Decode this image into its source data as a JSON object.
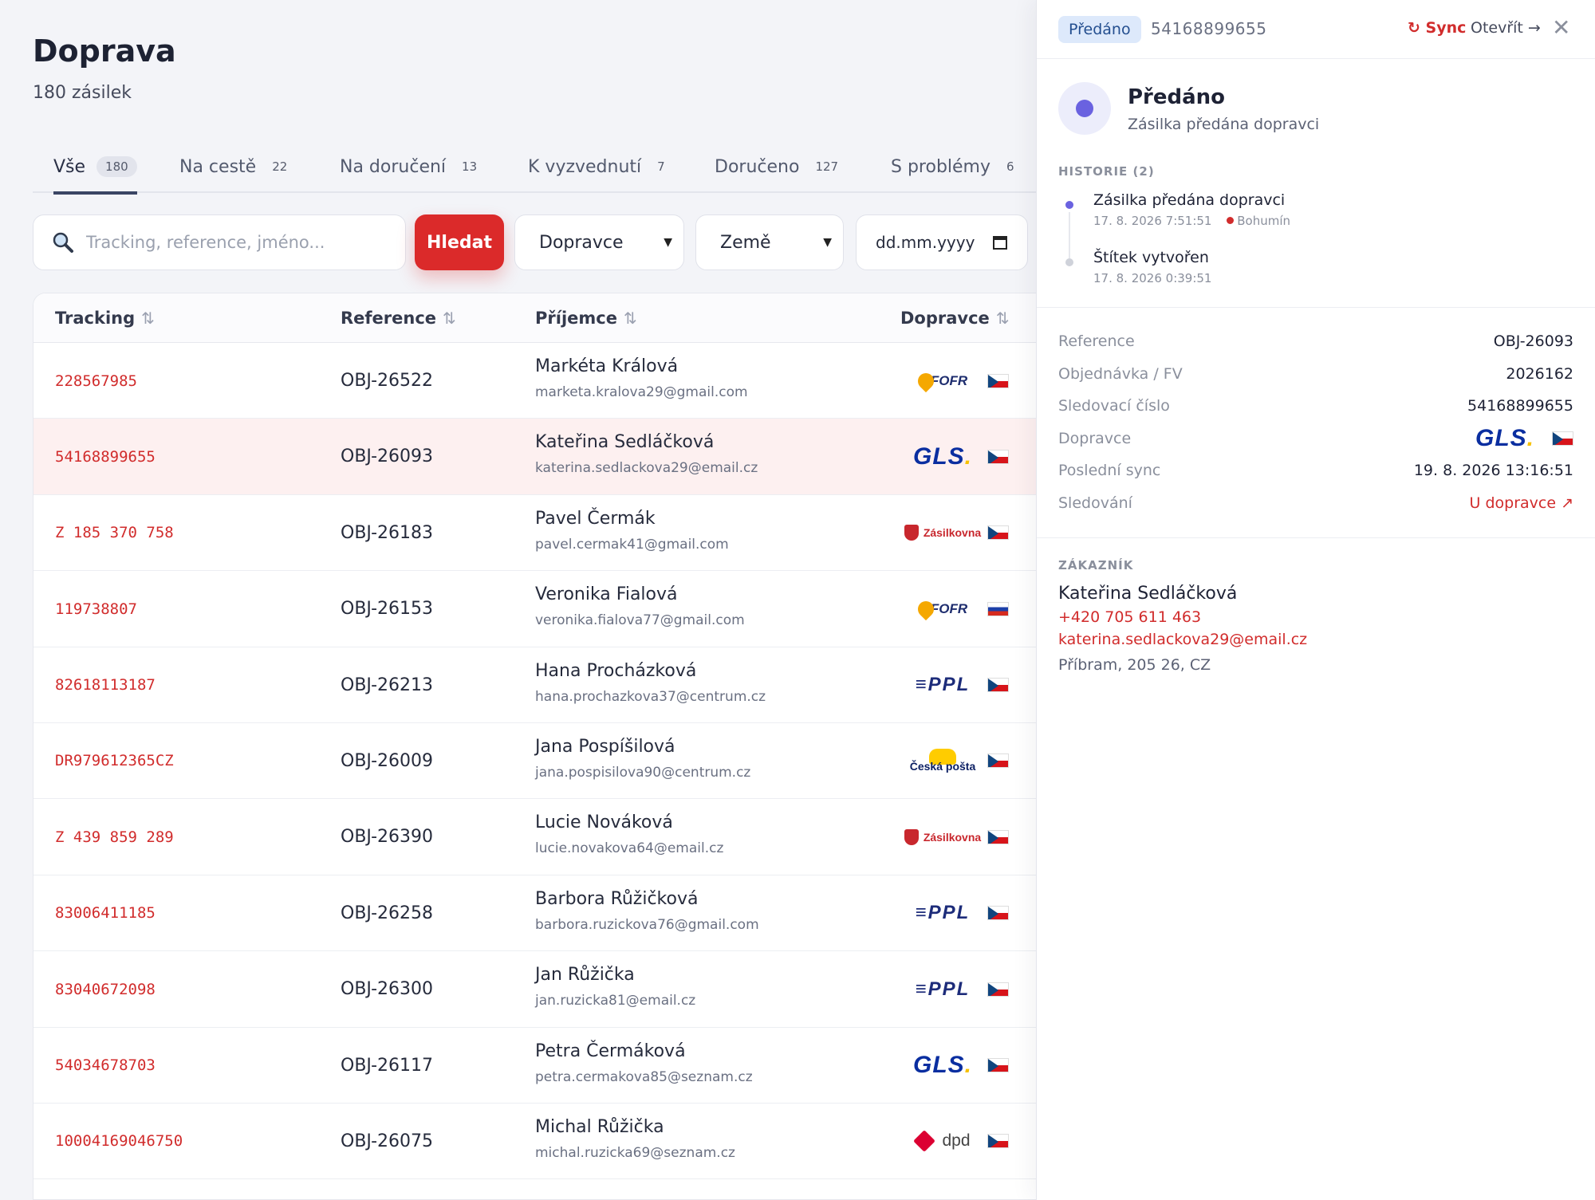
{
  "page": {
    "title": "Doprava",
    "subtitle": "180 zásilek"
  },
  "tabs": [
    {
      "label": "Vše",
      "count": "180"
    },
    {
      "label": "Na cestě",
      "count": "22"
    },
    {
      "label": "Na doručení",
      "count": "13"
    },
    {
      "label": "K vyzvednutí",
      "count": "7"
    },
    {
      "label": "Doručeno",
      "count": "127"
    },
    {
      "label": "S problémy",
      "count": "6"
    }
  ],
  "filters": {
    "search_placeholder": "Tracking, reference, jméno...",
    "search_button": "Hledat",
    "carrier_select": "Dopravce",
    "country_select": "Země",
    "date_placeholder": "dd.mm.yyyy"
  },
  "table": {
    "columns": [
      "Tracking",
      "Reference",
      "Příjemce",
      "Dopravce"
    ],
    "rows": [
      {
        "tracking": "228567985",
        "reference": "OBJ-26522",
        "name": "Markéta Králová",
        "email": "marketa.kralova29@gmail.com",
        "carrier": "fofr",
        "flag": "cz"
      },
      {
        "tracking": "54168899655",
        "reference": "OBJ-26093",
        "name": "Kateřina Sedláčková",
        "email": "katerina.sedlackova29@email.cz",
        "carrier": "gls",
        "flag": "cz"
      },
      {
        "tracking": "Z 185 370 758",
        "reference": "OBJ-26183",
        "name": "Pavel Čermák",
        "email": "pavel.cermak41@gmail.com",
        "carrier": "zasilkovna",
        "flag": "cz"
      },
      {
        "tracking": "119738807",
        "reference": "OBJ-26153",
        "name": "Veronika Fialová",
        "email": "veronika.fialova77@gmail.com",
        "carrier": "fofr",
        "flag": "ru"
      },
      {
        "tracking": "82618113187",
        "reference": "OBJ-26213",
        "name": "Hana Procházková",
        "email": "hana.prochazkova37@centrum.cz",
        "carrier": "ppl",
        "flag": "cz"
      },
      {
        "tracking": "DR979612365CZ",
        "reference": "OBJ-26009",
        "name": "Jana Pospíšilová",
        "email": "jana.pospisilova90@centrum.cz",
        "carrier": "ceskaposta",
        "flag": "cz"
      },
      {
        "tracking": "Z 439 859 289",
        "reference": "OBJ-26390",
        "name": "Lucie Nováková",
        "email": "lucie.novakova64@email.cz",
        "carrier": "zasilkovna",
        "flag": "cz"
      },
      {
        "tracking": "83006411185",
        "reference": "OBJ-26258",
        "name": "Barbora Růžičková",
        "email": "barbora.ruzickova76@gmail.com",
        "carrier": "ppl",
        "flag": "cz"
      },
      {
        "tracking": "83040672098",
        "reference": "OBJ-26300",
        "name": "Jan Růžička",
        "email": "jan.ruzicka81@email.cz",
        "carrier": "ppl",
        "flag": "cz"
      },
      {
        "tracking": "54034678703",
        "reference": "OBJ-26117",
        "name": "Petra Čermáková",
        "email": "petra.cermakova85@seznam.cz",
        "carrier": "gls",
        "flag": "cz"
      },
      {
        "tracking": "10004169046750",
        "reference": "OBJ-26075",
        "name": "Michal Růžička",
        "email": "michal.ruzicka69@seznam.cz",
        "carrier": "dpd",
        "flag": "cz"
      }
    ]
  },
  "carrier_logos": {
    "fofr": "FOFR",
    "gls": "GLS",
    "zasilkovna": "Zásilkovna",
    "ppl": "PPL",
    "ceskaposta": "Česká pošta",
    "dpd": "dpd"
  },
  "panel": {
    "badge": "Předáno",
    "tracking": "54168899655",
    "sync": "↻ Sync",
    "open": "Otevřít →",
    "close": "✕",
    "status_title": "Předáno",
    "status_desc": "Zásilka předána dopravci",
    "history_label": "HISTORIE (2)",
    "history": [
      {
        "title": "Zásilka předána dopravci",
        "date": "17. 8. 2026 7:51:51",
        "location": "Bohumín"
      },
      {
        "title": "Štítek vytvořen",
        "date": "17. 8. 2026 0:39:51",
        "location": ""
      }
    ],
    "info": {
      "reference_label": "Reference",
      "reference": "OBJ-26093",
      "order_label": "Objednávka / FV",
      "order": "2026162",
      "tracking_label": "Sledovací číslo",
      "tracking": "54168899655",
      "carrier_label": "Dopravce",
      "sync_label": "Poslední sync",
      "sync": "19. 8. 2026 13:16:51",
      "follow_label": "Sledování",
      "follow": "U dopravce ↗"
    },
    "customer_label": "ZÁKAZNÍK",
    "customer": {
      "name": "Kateřina Sedláčková",
      "phone": "+420 705 611 463",
      "email": "katerina.sedlackova29@email.cz",
      "address": "Příbram, 205 26, CZ"
    }
  },
  "colors": {
    "accent": "#db2a2a",
    "badge_bg": "#dde9fb",
    "status_dot": "#6a62e0"
  },
  "icons": {
    "search": "search-icon",
    "sort": "sort-icon",
    "calendar": "calendar-icon",
    "chevron": "chevron-down-icon",
    "close": "close-icon"
  }
}
